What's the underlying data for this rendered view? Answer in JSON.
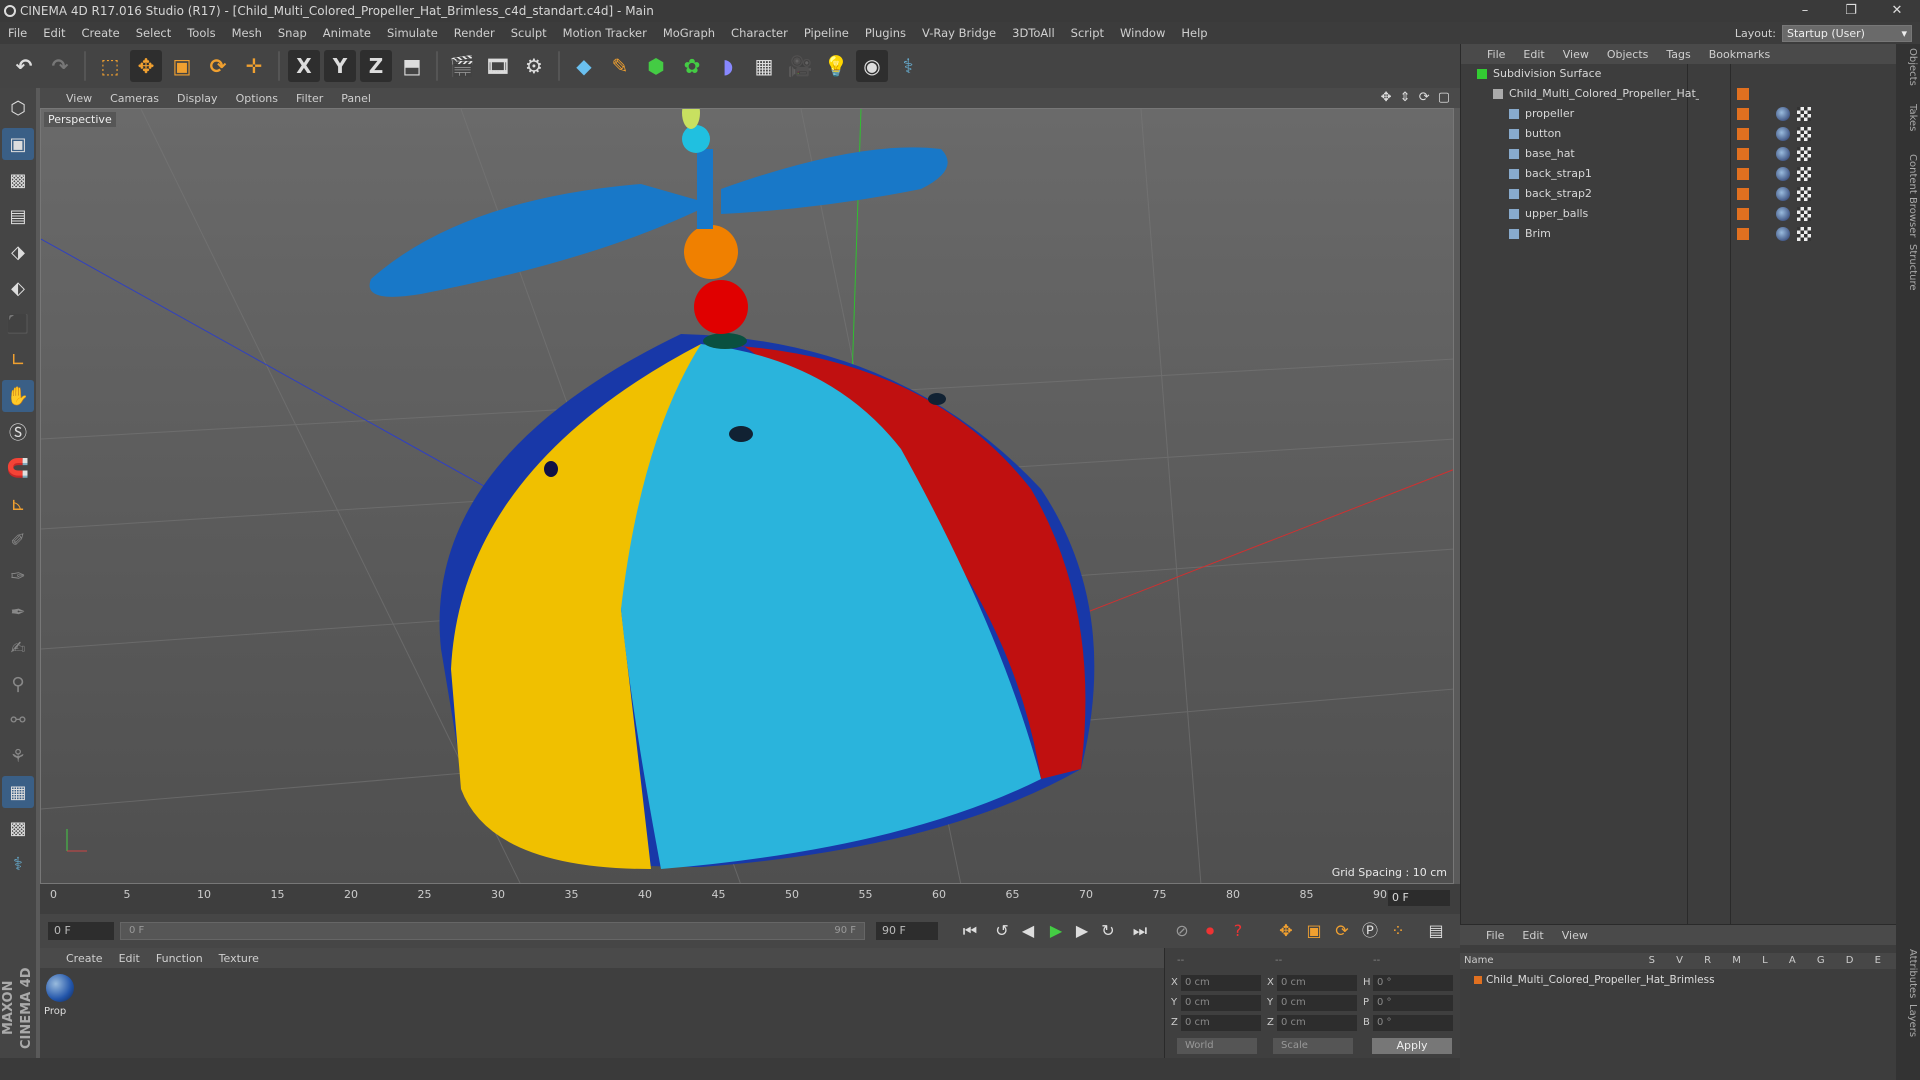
{
  "window": {
    "title": "CINEMA 4D R17.016 Studio (R17) - [Child_Multi_Colored_Propeller_Hat_Brimless_c4d_standart.c4d] - Main",
    "controls": [
      "–",
      "❐",
      "✕"
    ]
  },
  "menubar": [
    "File",
    "Edit",
    "Create",
    "Select",
    "Tools",
    "Mesh",
    "Snap",
    "Animate",
    "Simulate",
    "Render",
    "Sculpt",
    "Motion Tracker",
    "MoGraph",
    "Character",
    "Pipeline",
    "Plugins",
    "V-Ray Bridge",
    "3DToAll",
    "Script",
    "Window",
    "Help"
  ],
  "layout": {
    "label": "Layout:",
    "value": "Startup (User)"
  },
  "toolbar": {
    "axis_x": "X",
    "axis_y": "Y",
    "axis_z": "Z"
  },
  "viewport": {
    "menu": [
      "View",
      "Cameras",
      "Display",
      "Options",
      "Filter",
      "Panel"
    ],
    "label": "Perspective",
    "grid_spacing": "Grid Spacing : 10 cm",
    "nav_icons": "✥ ⇕ ⟳ ▢"
  },
  "timeline": {
    "ticks": [
      "0",
      "5",
      "10",
      "15",
      "20",
      "25",
      "30",
      "35",
      "40",
      "45",
      "50",
      "55",
      "60",
      "65",
      "70",
      "75",
      "80",
      "85",
      "90"
    ],
    "current": "0 F"
  },
  "transport": {
    "start": "0 F",
    "scrub_start": "0 F",
    "scrub_end": "90 F",
    "end": "90 F"
  },
  "material": {
    "menu": [
      "Create",
      "Edit",
      "Function",
      "Texture"
    ],
    "item": "Prop"
  },
  "coordinates": {
    "header_left": "--",
    "header_mid": "--",
    "header_right": "--",
    "rows": [
      {
        "a": "X",
        "av": "0 cm",
        "b": "X",
        "bv": "0 cm",
        "c": "H",
        "cv": "0 °"
      },
      {
        "a": "Y",
        "av": "0 cm",
        "b": "Y",
        "bv": "0 cm",
        "c": "P",
        "cv": "0 °"
      },
      {
        "a": "Z",
        "av": "0 cm",
        "b": "Z",
        "bv": "0 cm",
        "c": "B",
        "cv": "0 °"
      }
    ],
    "mode": "World",
    "scale": "Scale",
    "apply": "Apply"
  },
  "brand": "MAXON CINEMA 4D",
  "objects": {
    "menu": [
      "File",
      "Edit",
      "View",
      "Objects",
      "Tags",
      "Bookmarks"
    ],
    "tree": [
      {
        "name": "Subdivision Surface",
        "level": 0
      },
      {
        "name": "Child_Multi_Colored_Propeller_Hat_Brimless",
        "level": 1
      },
      {
        "name": "propeller",
        "level": 2
      },
      {
        "name": "button",
        "level": 2
      },
      {
        "name": "base_hat",
        "level": 2
      },
      {
        "name": "back_strap1",
        "level": 2
      },
      {
        "name": "back_strap2",
        "level": 2
      },
      {
        "name": "upper_balls",
        "level": 2
      },
      {
        "name": "Brim",
        "level": 2
      }
    ]
  },
  "attributes": {
    "menu": [
      "File",
      "Edit",
      "View"
    ],
    "header_name": "Name",
    "header_cols": "S V R M L A G D E",
    "row": "Child_Multi_Colored_Propeller_Hat_Brimless"
  },
  "right_tabs": [
    "Objects",
    "Takes",
    "Content Browser",
    "Structure",
    "Attributes",
    "Layers"
  ],
  "colors": {
    "accent": "#3a5f86",
    "hat_yellow": "#f0c000",
    "hat_cyan": "#2ab4dc",
    "hat_red": "#c01010",
    "hat_blue": "#1838a8",
    "propeller": "#1878c8",
    "ball_orange": "#f08000",
    "ball_red": "#e00000"
  }
}
